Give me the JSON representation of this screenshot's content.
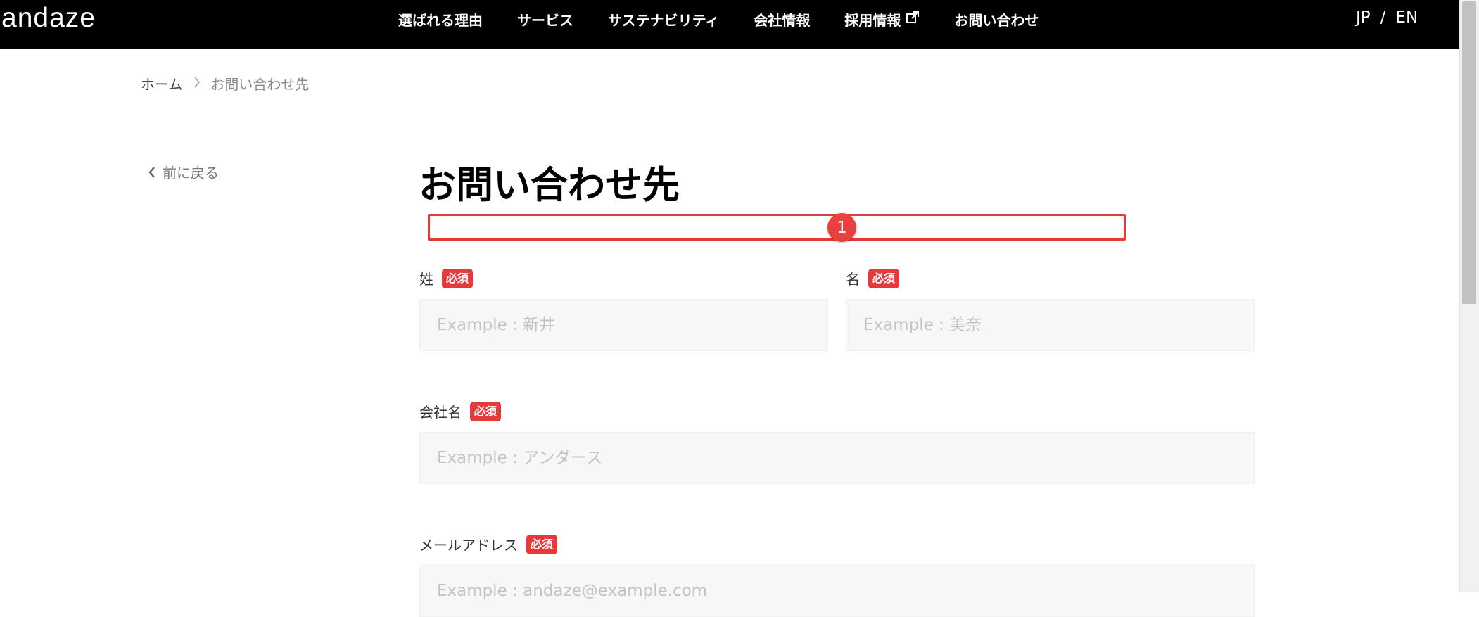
{
  "header": {
    "logo": "andaze",
    "nav": [
      {
        "label": "選ばれる理由"
      },
      {
        "label": "サービス"
      },
      {
        "label": "サステナビリティ"
      },
      {
        "label": "会社情報"
      },
      {
        "label": "採用情報",
        "icon": "external-link-icon"
      },
      {
        "label": "お問い合わせ"
      }
    ],
    "lang": {
      "jp": "JP",
      "sep": "/",
      "en": "EN"
    }
  },
  "breadcrumb": {
    "home": "ホーム",
    "current": "お問い合わせ先"
  },
  "back_label": "前に戻る",
  "page_title": "お問い合わせ先",
  "annotation": {
    "number": "1"
  },
  "form": {
    "required_label": "必須",
    "last_name": {
      "label": "姓",
      "placeholder": "Example : 新井"
    },
    "first_name": {
      "label": "名",
      "placeholder": "Example : 美奈"
    },
    "company": {
      "label": "会社名",
      "placeholder": "Example : アンダース"
    },
    "email": {
      "label": "メールアドレス",
      "placeholder": "Example : andaze@example.com"
    }
  },
  "colors": {
    "accent": "#e5393b",
    "header_bg": "#000000",
    "annotation": "#e3383c"
  }
}
